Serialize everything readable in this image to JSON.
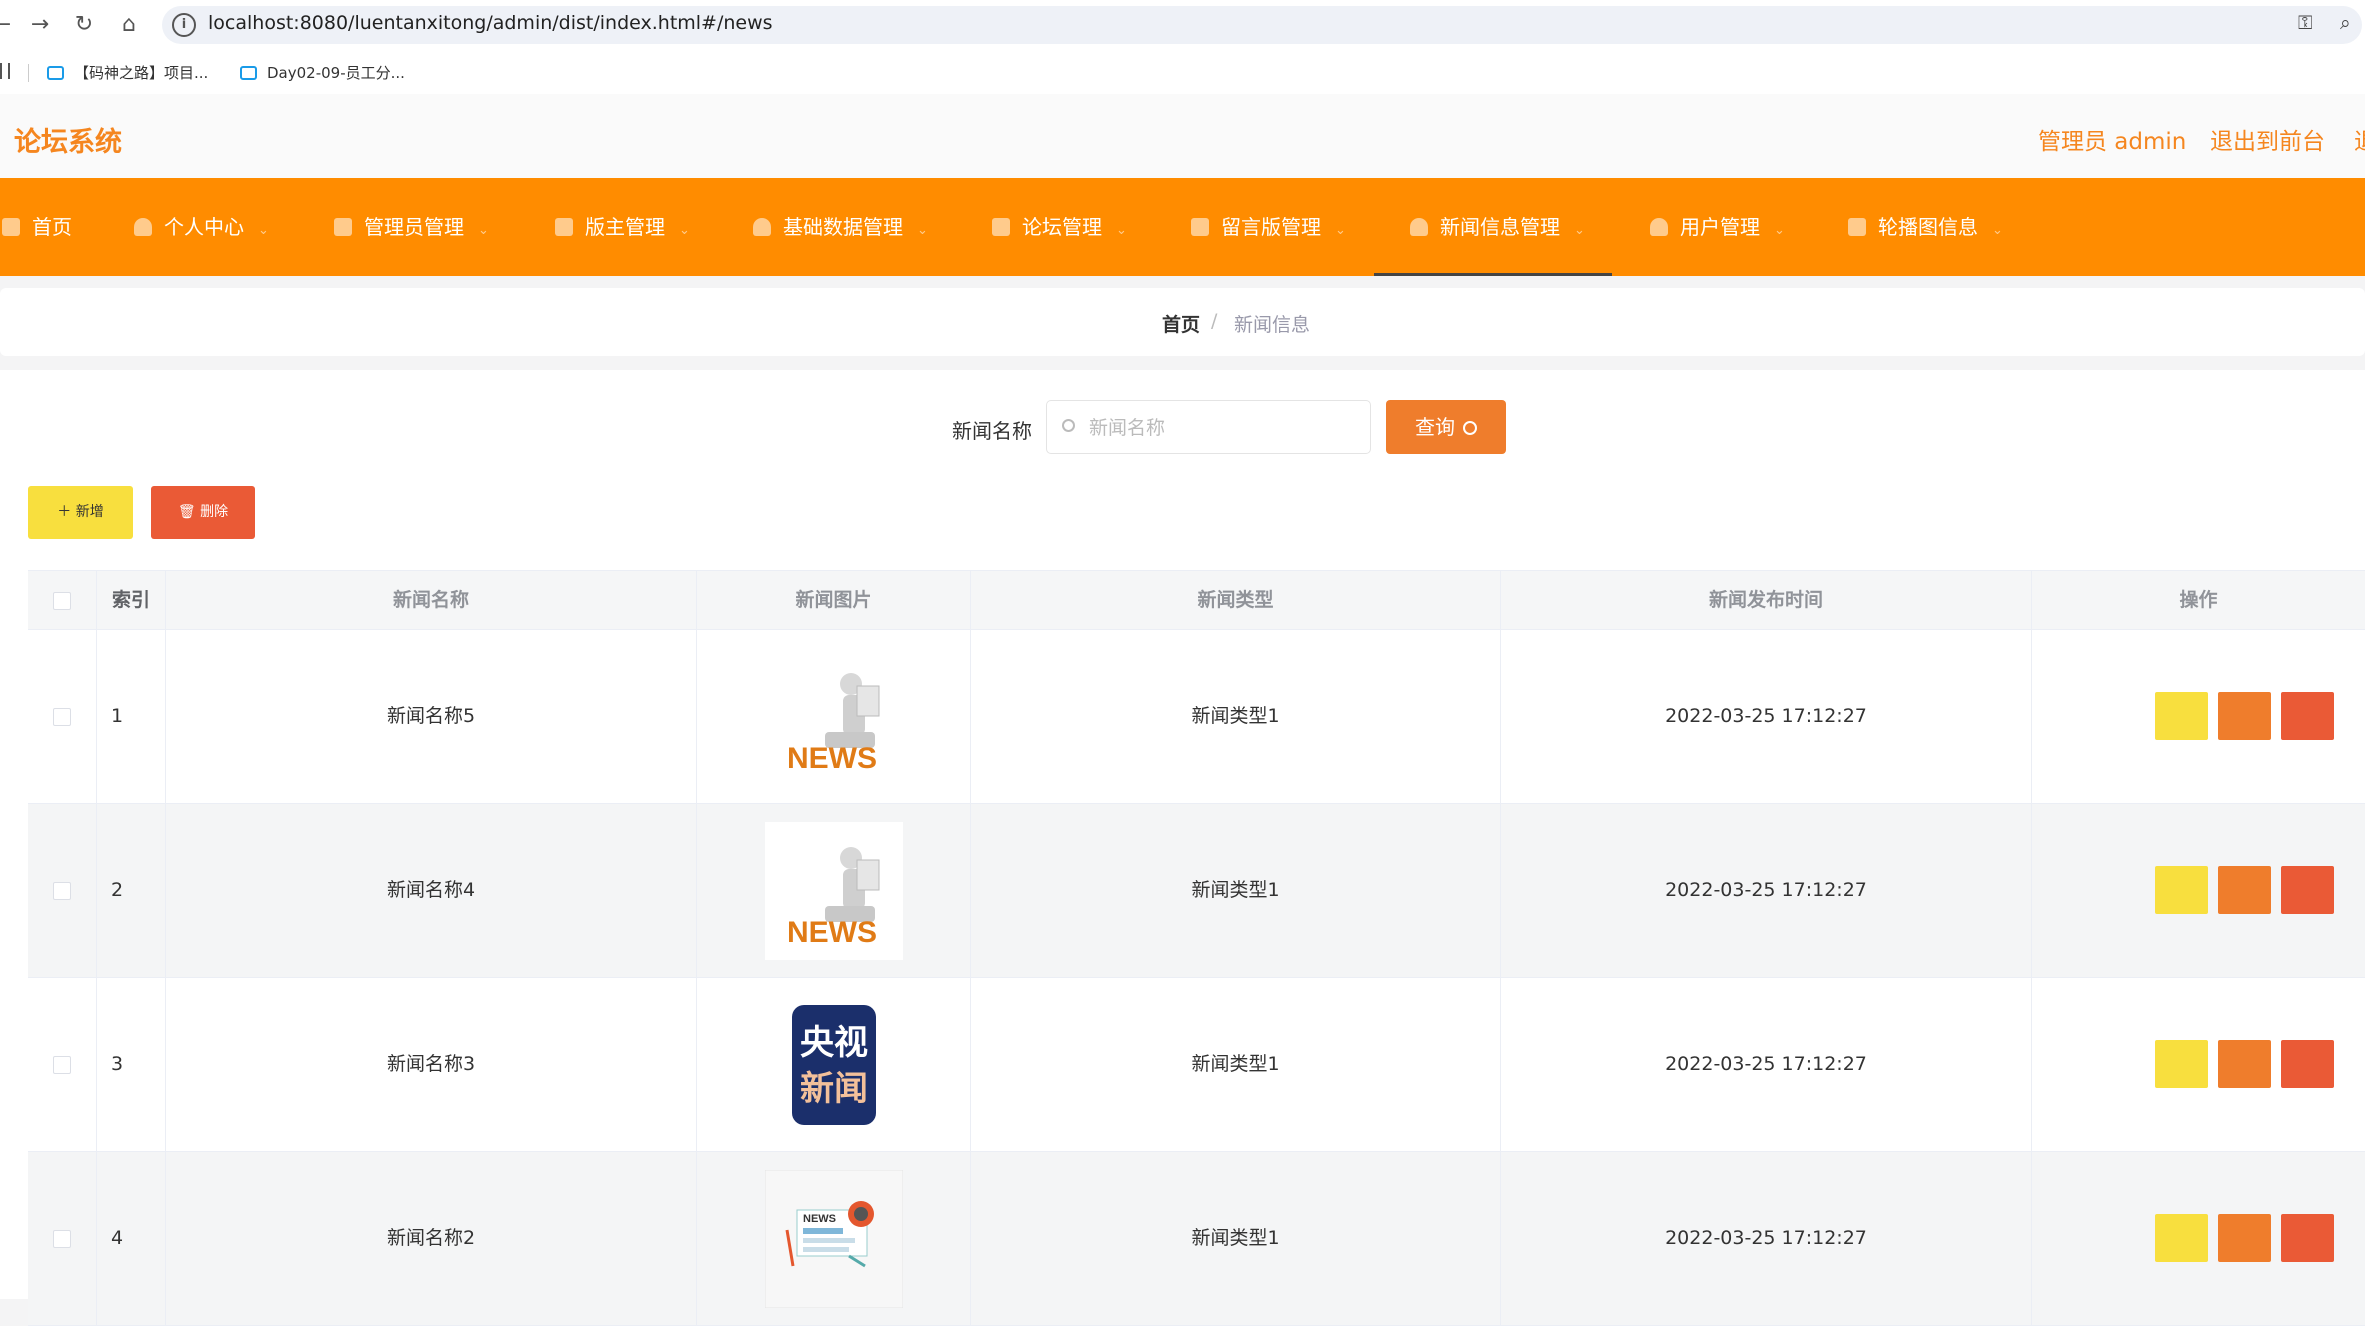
{
  "browser": {
    "url": "localhost:8080/luentanxitong/admin/dist/index.html#/news",
    "bookmarks": [
      "【码神之路】项目...",
      "Day02-09-员工分..."
    ]
  },
  "header": {
    "title": "论坛系统",
    "user_label": "管理员 admin",
    "exit_front": "退出到前台",
    "exit_partial": "退"
  },
  "nav": {
    "items": [
      {
        "label": "首页",
        "icon": "home-icon"
      },
      {
        "label": "个人中心",
        "icon": "user-icon"
      },
      {
        "label": "管理员管理",
        "icon": "briefcase-icon"
      },
      {
        "label": "版主管理",
        "icon": "book-icon"
      },
      {
        "label": "基础数据管理",
        "icon": "clock-icon"
      },
      {
        "label": "论坛管理",
        "icon": "calendar-icon"
      },
      {
        "label": "留言版管理",
        "icon": "list-icon"
      },
      {
        "label": "新闻信息管理",
        "icon": "user-icon"
      },
      {
        "label": "用户管理",
        "icon": "user-icon"
      },
      {
        "label": "轮播图信息",
        "icon": "phone-icon"
      }
    ],
    "active": "新闻信息管理"
  },
  "breadcrumb": {
    "home": "首页",
    "separator": "/",
    "current": "新闻信息"
  },
  "search": {
    "label": "新闻名称",
    "placeholder": "新闻名称",
    "value": "",
    "query_button": "查询"
  },
  "actions": {
    "add": "＋ 新增",
    "delete": "删除"
  },
  "table": {
    "columns": [
      "",
      "索引",
      "新闻名称",
      "新闻图片",
      "新闻类型",
      "新闻发布时间",
      "操作"
    ],
    "rows": [
      {
        "index": "1",
        "name": "新闻名称5",
        "image": "news-3d-figure",
        "type": "新闻类型1",
        "time": "2022-03-25 17:12:27"
      },
      {
        "index": "2",
        "name": "新闻名称4",
        "image": "news-3d-figure",
        "type": "新闻类型1",
        "time": "2022-03-25 17:12:27"
      },
      {
        "index": "3",
        "name": "新闻名称3",
        "image": "cctv-news-logo",
        "image_text": [
          "央视",
          "新闻"
        ],
        "type": "新闻类型1",
        "time": "2022-03-25 17:12:27"
      },
      {
        "index": "4",
        "name": "新闻名称2",
        "image": "news-paper-illustration",
        "image_text": [
          "NEWS"
        ],
        "type": "新闻类型1",
        "time": "2022-03-25 17:12:27"
      }
    ],
    "news_word": "NEWS"
  },
  "colors": {
    "accent": "#ff8c00",
    "title": "#f5861f",
    "query": "#ef7d2c",
    "add": "#f8df3e",
    "delete": "#ea5a36"
  }
}
